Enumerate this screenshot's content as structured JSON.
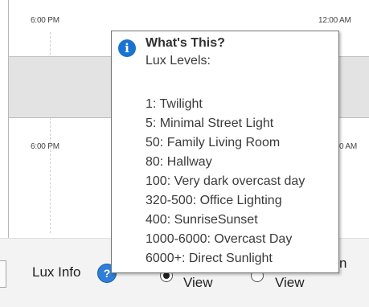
{
  "chart": {
    "time_top_left": "6:00 PM",
    "time_top_right": "12:00 AM",
    "time_mid_left": "6:00 PM",
    "time_mid_right_partial": "0 AM"
  },
  "tooltip": {
    "title": "What's This?",
    "subtitle": "Lux Levels:",
    "lines": [
      "1: Twilight",
      "5: Minimal Street Light",
      "50: Family Living Room",
      "80: Hallway",
      "100: Very dark overcast day",
      "320-500: Office Lighting",
      "400: SunriseSunset",
      "1000-6000: Overcast Day",
      "6000+: Direct Sunlight"
    ]
  },
  "controls": {
    "lux_info_label": "Lux Info",
    "help_glyph": "?",
    "info_glyph": "i",
    "view_label_1": "View",
    "view_label_2": "View",
    "partial_text": "n",
    "selected_view_index": 0
  },
  "icons": {
    "info": "info-icon",
    "help": "help-icon"
  },
  "colors": {
    "info_blue": "#1a73d1",
    "help_blue": "#2f7ed8",
    "band_gray": "#e3e3e3"
  }
}
